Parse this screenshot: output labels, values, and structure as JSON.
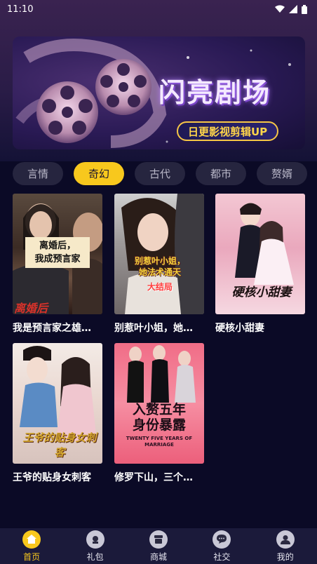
{
  "status": {
    "time": "11:10"
  },
  "banner": {
    "title": "闪亮剧场",
    "subtitle": "日更影视剪辑UP"
  },
  "categories": [
    {
      "label": "言情",
      "active": false
    },
    {
      "label": "奇幻",
      "active": true
    },
    {
      "label": "古代",
      "active": false
    },
    {
      "label": "都市",
      "active": false
    },
    {
      "label": "赘婿",
      "active": false
    }
  ],
  "videos": [
    {
      "title": "我是预言家之雄…",
      "poster_text": "离婚后，\n我成预言家",
      "poster_sub": "离婚后"
    },
    {
      "title": "别惹叶小姐，她…",
      "poster_text": "别惹叶小姐，\n她法术通天",
      "poster_sub": "大结局"
    },
    {
      "title": "硬核小甜妻",
      "poster_text": "硬核小甜妻",
      "poster_sub": ""
    },
    {
      "title": "王爷的贴身女刺客",
      "poster_text": "王爷的贴身女刺客",
      "poster_sub": ""
    },
    {
      "title": "修罗下山，三个…",
      "poster_text": "入赘五年\n身份暴露",
      "poster_sub": "TWENTY FIVE YEARS OF MARRIAGE"
    }
  ],
  "tabbar": [
    {
      "label": "首页",
      "icon": "home-icon",
      "active": true
    },
    {
      "label": "礼包",
      "icon": "gift-icon",
      "active": false
    },
    {
      "label": "商城",
      "icon": "shop-icon",
      "active": false
    },
    {
      "label": "社交",
      "icon": "chat-icon",
      "active": false
    },
    {
      "label": "我的",
      "icon": "user-icon",
      "active": false
    }
  ],
  "colors": {
    "accent": "#f8c81d",
    "background": "#0b0a26",
    "chip": "#26253f"
  }
}
